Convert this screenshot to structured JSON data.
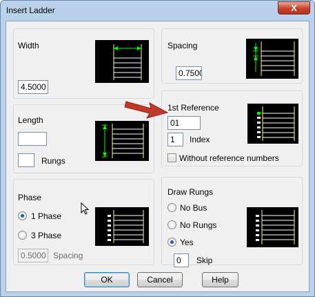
{
  "window": {
    "title": "Insert Ladder",
    "close_label": "X"
  },
  "width_group": {
    "label": "Width",
    "value": "4.5000"
  },
  "spacing_group": {
    "label": "Spacing",
    "value": "0.7500"
  },
  "length_group": {
    "label": "Length",
    "value": "",
    "rungs_value": "",
    "rungs_label": "Rungs"
  },
  "reference_group": {
    "label": "1st Reference",
    "value": "01",
    "index_value": "1",
    "index_label": "Index",
    "without_ref_label": "Without reference numbers",
    "without_ref_checked": false
  },
  "phase_group": {
    "label": "Phase",
    "option1": "1 Phase",
    "option3": "3 Phase",
    "selected": "1 Phase",
    "spacing_value": "0.5000",
    "spacing_label": "Spacing"
  },
  "rungs_group": {
    "label": "Draw Rungs",
    "no_bus": "No Bus",
    "no_rungs": "No Rungs",
    "yes": "Yes",
    "selected": "Yes",
    "skip_value": "0",
    "skip_label": "Skip"
  },
  "buttons": {
    "ok": "OK",
    "cancel": "Cancel",
    "help": "Help"
  },
  "icons": {
    "arrow": "red-pointer-arrow-icon",
    "cursor": "mouse-cursor-icon",
    "previews": [
      "width-preview-icon",
      "spacing-preview-icon",
      "length-preview-icon",
      "reference-preview-icon",
      "phase-preview-icon",
      "rungs-preview-icon"
    ]
  },
  "colors": {
    "preview_bg": "#000000",
    "rail": "#ffff80",
    "dimension": "#00ff00",
    "arrow": "#c0392b"
  }
}
